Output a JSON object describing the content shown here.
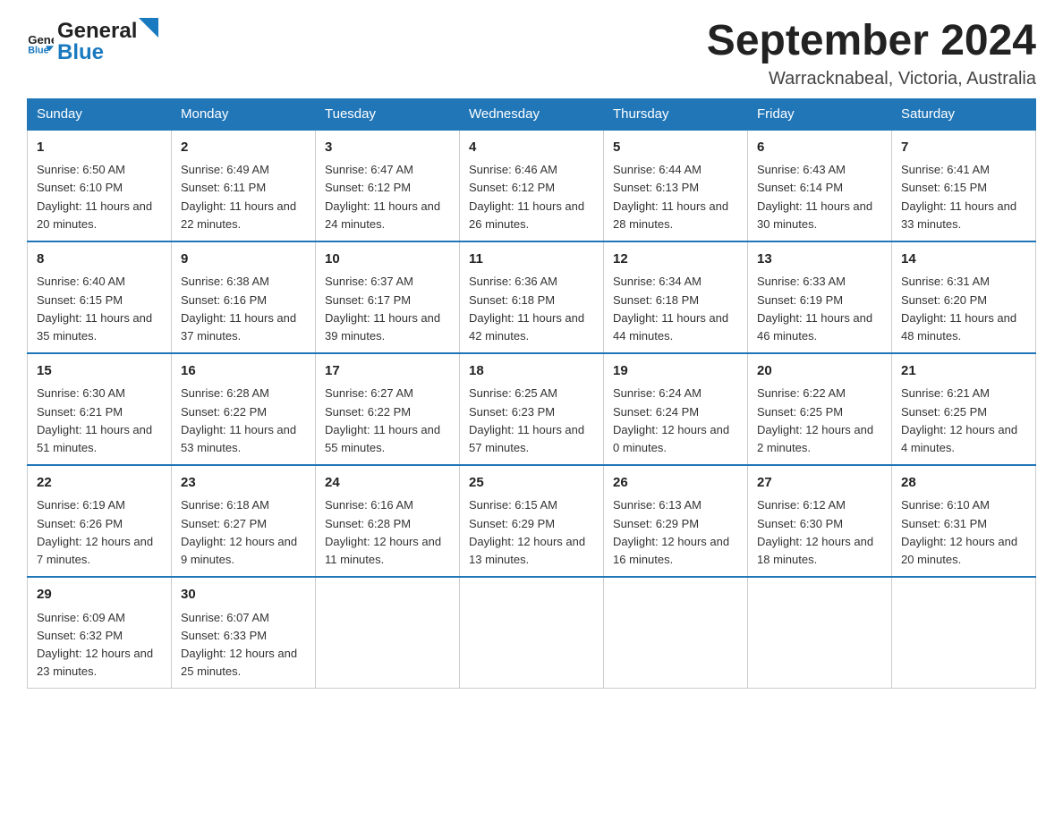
{
  "logo": {
    "text_general": "General",
    "text_blue": "Blue"
  },
  "header": {
    "month": "September 2024",
    "location": "Warracknabeal, Victoria, Australia"
  },
  "days_of_week": [
    "Sunday",
    "Monday",
    "Tuesday",
    "Wednesday",
    "Thursday",
    "Friday",
    "Saturday"
  ],
  "weeks": [
    [
      {
        "day": "1",
        "sunrise": "6:50 AM",
        "sunset": "6:10 PM",
        "daylight": "11 hours and 20 minutes."
      },
      {
        "day": "2",
        "sunrise": "6:49 AM",
        "sunset": "6:11 PM",
        "daylight": "11 hours and 22 minutes."
      },
      {
        "day": "3",
        "sunrise": "6:47 AM",
        "sunset": "6:12 PM",
        "daylight": "11 hours and 24 minutes."
      },
      {
        "day": "4",
        "sunrise": "6:46 AM",
        "sunset": "6:12 PM",
        "daylight": "11 hours and 26 minutes."
      },
      {
        "day": "5",
        "sunrise": "6:44 AM",
        "sunset": "6:13 PM",
        "daylight": "11 hours and 28 minutes."
      },
      {
        "day": "6",
        "sunrise": "6:43 AM",
        "sunset": "6:14 PM",
        "daylight": "11 hours and 30 minutes."
      },
      {
        "day": "7",
        "sunrise": "6:41 AM",
        "sunset": "6:15 PM",
        "daylight": "11 hours and 33 minutes."
      }
    ],
    [
      {
        "day": "8",
        "sunrise": "6:40 AM",
        "sunset": "6:15 PM",
        "daylight": "11 hours and 35 minutes."
      },
      {
        "day": "9",
        "sunrise": "6:38 AM",
        "sunset": "6:16 PM",
        "daylight": "11 hours and 37 minutes."
      },
      {
        "day": "10",
        "sunrise": "6:37 AM",
        "sunset": "6:17 PM",
        "daylight": "11 hours and 39 minutes."
      },
      {
        "day": "11",
        "sunrise": "6:36 AM",
        "sunset": "6:18 PM",
        "daylight": "11 hours and 42 minutes."
      },
      {
        "day": "12",
        "sunrise": "6:34 AM",
        "sunset": "6:18 PM",
        "daylight": "11 hours and 44 minutes."
      },
      {
        "day": "13",
        "sunrise": "6:33 AM",
        "sunset": "6:19 PM",
        "daylight": "11 hours and 46 minutes."
      },
      {
        "day": "14",
        "sunrise": "6:31 AM",
        "sunset": "6:20 PM",
        "daylight": "11 hours and 48 minutes."
      }
    ],
    [
      {
        "day": "15",
        "sunrise": "6:30 AM",
        "sunset": "6:21 PM",
        "daylight": "11 hours and 51 minutes."
      },
      {
        "day": "16",
        "sunrise": "6:28 AM",
        "sunset": "6:22 PM",
        "daylight": "11 hours and 53 minutes."
      },
      {
        "day": "17",
        "sunrise": "6:27 AM",
        "sunset": "6:22 PM",
        "daylight": "11 hours and 55 minutes."
      },
      {
        "day": "18",
        "sunrise": "6:25 AM",
        "sunset": "6:23 PM",
        "daylight": "11 hours and 57 minutes."
      },
      {
        "day": "19",
        "sunrise": "6:24 AM",
        "sunset": "6:24 PM",
        "daylight": "12 hours and 0 minutes."
      },
      {
        "day": "20",
        "sunrise": "6:22 AM",
        "sunset": "6:25 PM",
        "daylight": "12 hours and 2 minutes."
      },
      {
        "day": "21",
        "sunrise": "6:21 AM",
        "sunset": "6:25 PM",
        "daylight": "12 hours and 4 minutes."
      }
    ],
    [
      {
        "day": "22",
        "sunrise": "6:19 AM",
        "sunset": "6:26 PM",
        "daylight": "12 hours and 7 minutes."
      },
      {
        "day": "23",
        "sunrise": "6:18 AM",
        "sunset": "6:27 PM",
        "daylight": "12 hours and 9 minutes."
      },
      {
        "day": "24",
        "sunrise": "6:16 AM",
        "sunset": "6:28 PM",
        "daylight": "12 hours and 11 minutes."
      },
      {
        "day": "25",
        "sunrise": "6:15 AM",
        "sunset": "6:29 PM",
        "daylight": "12 hours and 13 minutes."
      },
      {
        "day": "26",
        "sunrise": "6:13 AM",
        "sunset": "6:29 PM",
        "daylight": "12 hours and 16 minutes."
      },
      {
        "day": "27",
        "sunrise": "6:12 AM",
        "sunset": "6:30 PM",
        "daylight": "12 hours and 18 minutes."
      },
      {
        "day": "28",
        "sunrise": "6:10 AM",
        "sunset": "6:31 PM",
        "daylight": "12 hours and 20 minutes."
      }
    ],
    [
      {
        "day": "29",
        "sunrise": "6:09 AM",
        "sunset": "6:32 PM",
        "daylight": "12 hours and 23 minutes."
      },
      {
        "day": "30",
        "sunrise": "6:07 AM",
        "sunset": "6:33 PM",
        "daylight": "12 hours and 25 minutes."
      },
      null,
      null,
      null,
      null,
      null
    ]
  ],
  "labels": {
    "sunrise": "Sunrise:",
    "sunset": "Sunset:",
    "daylight": "Daylight:"
  }
}
